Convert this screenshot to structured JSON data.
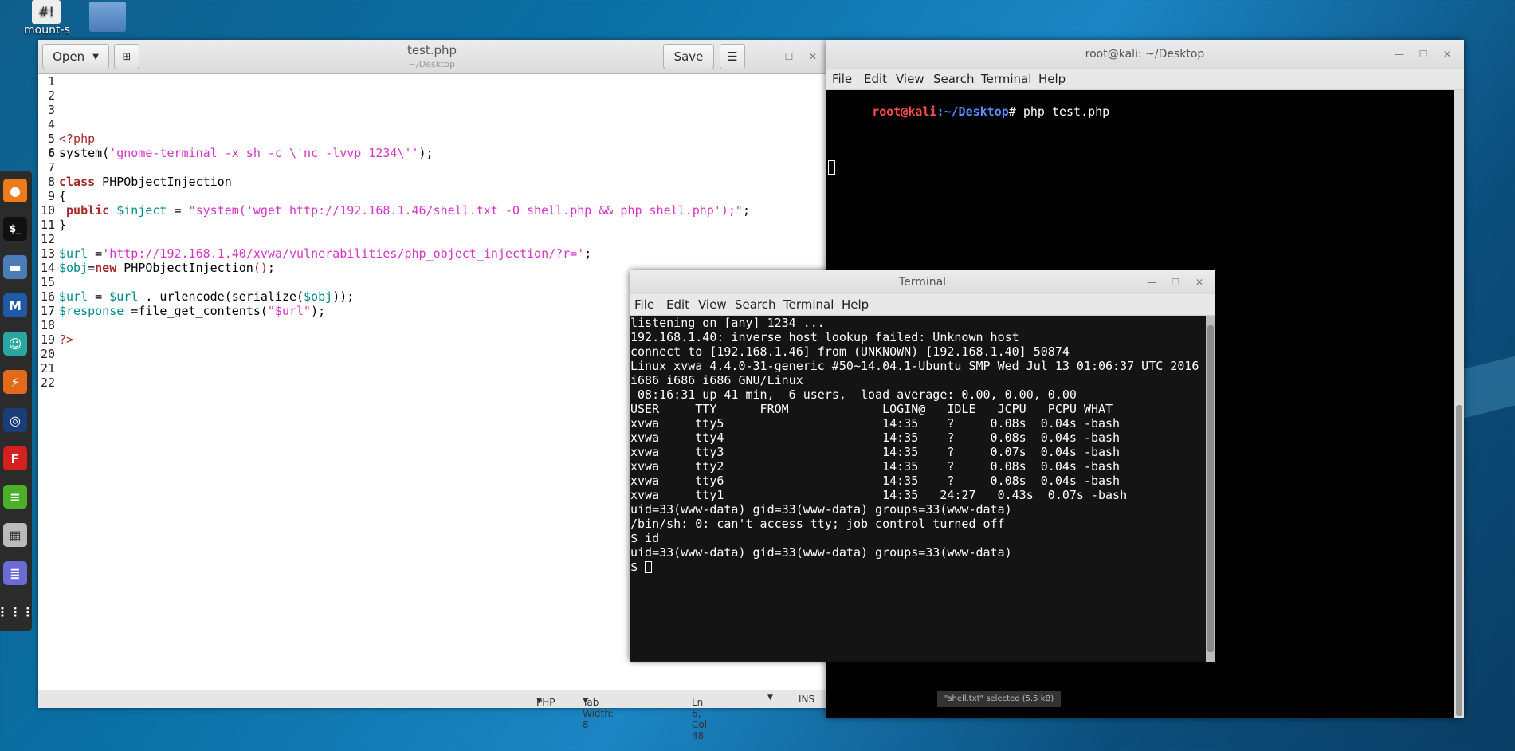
{
  "desktop": {
    "icons": [
      {
        "label": "mount-shared-folders",
        "glyph": "#!"
      },
      {
        "label": "",
        "glyph": ""
      }
    ],
    "dock_icons": [
      "firefox-icon",
      "terminal-icon",
      "files-icon",
      "metasploit-icon",
      "armitage-icon",
      "burpsuite-icon",
      "maltego-icon",
      "faraday-icon",
      "leafpad-icon",
      "cutycapt-icon",
      "gedit-icon",
      "apps-grid-icon"
    ]
  },
  "gedit": {
    "title": "test.php",
    "subtitle": "~/Desktop",
    "open_label": "Open",
    "save_label": "Save",
    "line_numbers": [
      "1",
      "2",
      "3",
      "4",
      "5",
      "6",
      "7",
      "8",
      "9",
      "10",
      "11",
      "12",
      "13",
      "14",
      "15",
      "16",
      "17",
      "18",
      "19",
      "20",
      "21",
      "22"
    ],
    "status": {
      "language": "PHP",
      "tab_width": "Tab Width: 8",
      "position": "Ln 6, Col 48",
      "mode": "INS"
    }
  },
  "terminal_back": {
    "title": "root@kali: ~/Desktop",
    "menu": [
      "File",
      "Edit",
      "View",
      "Search",
      "Terminal",
      "Help"
    ],
    "prompt_user": "root@kali",
    "prompt_path": ":~/Desktop",
    "prompt_cmd": "# php test.php",
    "notification": "\"shell.txt\" selected  (5.5 kB)"
  },
  "terminal_front": {
    "title": "Terminal",
    "menu": [
      "File",
      "Edit",
      "View",
      "Search",
      "Terminal",
      "Help"
    ],
    "lines": [
      "listening on [any] 1234 ...",
      "192.168.1.40: inverse host lookup failed: Unknown host",
      "connect to [192.168.1.46] from (UNKNOWN) [192.168.1.40] 50874",
      "Linux xvwa 4.4.0-31-generic #50~14.04.1-Ubuntu SMP Wed Jul 13 01:06:37 UTC 2016",
      "i686 i686 i686 GNU/Linux",
      " 08:16:31 up 41 min,  6 users,  load average: 0.00, 0.00, 0.00",
      "USER     TTY      FROM             LOGIN@   IDLE   JCPU   PCPU WHAT",
      "xvwa     tty5                      14:35    ?     0.08s  0.04s -bash",
      "xvwa     tty4                      14:35    ?     0.08s  0.04s -bash",
      "xvwa     tty3                      14:35    ?     0.07s  0.04s -bash",
      "xvwa     tty2                      14:35    ?     0.08s  0.04s -bash",
      "xvwa     tty6                      14:35    ?     0.08s  0.04s -bash",
      "xvwa     tty1                      14:35   24:27   0.43s  0.07s -bash",
      "uid=33(www-data) gid=33(www-data) groups=33(www-data)",
      "/bin/sh: 0: can't access tty; job control turned off",
      "$ id",
      "uid=33(www-data) gid=33(www-data) groups=33(www-data)"
    ],
    "prompt": "$ "
  }
}
